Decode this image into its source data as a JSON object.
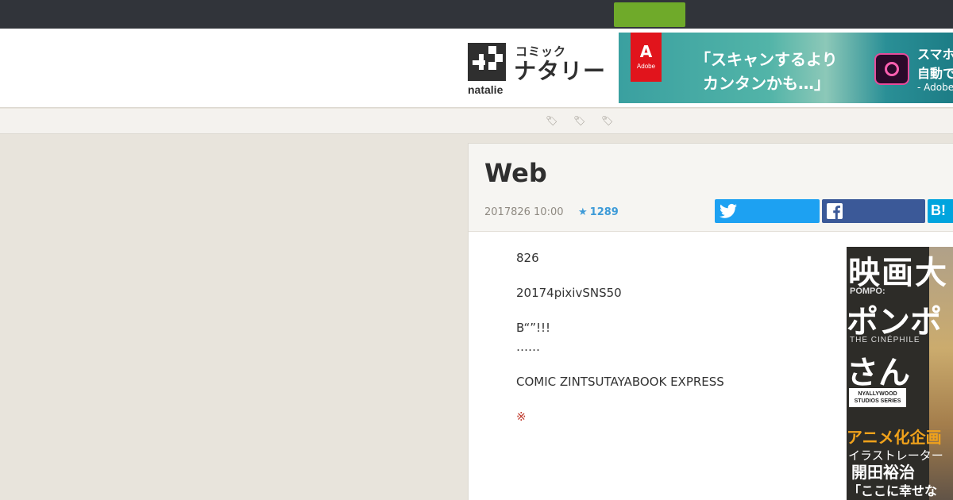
{
  "header": {
    "logo": {
      "category": "コミック",
      "brand": "ナタリー",
      "wordmark": "natalie"
    },
    "ad": {
      "adobe_label": "Adobe",
      "line1": "「スキャンするより",
      "line2": "カンタンかも…」",
      "side_line1": "スマホ",
      "side_line2": "自動で",
      "side_line3": "- Adobe"
    }
  },
  "tags": [
    "",
    "",
    ""
  ],
  "article": {
    "title": "Web",
    "date": "2017826 10:00",
    "favorites": "1289",
    "share": {
      "twitter_icon": "twitter-icon",
      "facebook_icon": "facebook-icon",
      "hatena_label": "B!"
    },
    "paragraphs": [
      "826",
      "20174pixivSNS50",
      "B“”!!!",
      "……",
      "COMIC ZINTSUTAYABOOK EXPRESS"
    ],
    "note": "※",
    "cover": {
      "t1": "映画大",
      "t2": "POMPO:",
      "t3": "ポンポ",
      "t4": "THE CINÉPHILE",
      "t5": "さん",
      "badge_line1": "NYALLYWOOD",
      "badge_line2": "STUDIOS SERIES",
      "t6": "アニメ化企画",
      "t7": "イラストレーター",
      "t8": "開田裕治",
      "t9": "「ここに幸せな"
    }
  },
  "colors": {
    "topbar": "#31343a",
    "green_button": "#6faa2a",
    "twitter": "#1da1f2",
    "facebook": "#3b5998",
    "hatena": "#00a4de",
    "favorite_accent": "#3e9bd8"
  }
}
